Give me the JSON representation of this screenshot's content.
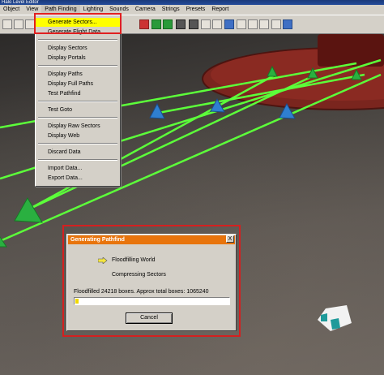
{
  "window": {
    "title": "Halo Level Editor"
  },
  "menubar": [
    {
      "label": "Object"
    },
    {
      "label": "View"
    },
    {
      "label": "Path Finding"
    },
    {
      "label": "Lighting"
    },
    {
      "label": "Sounds"
    },
    {
      "label": "Camera"
    },
    {
      "label": "Strings"
    },
    {
      "label": "Presets"
    },
    {
      "label": "Report"
    }
  ],
  "dropdown": {
    "items": [
      {
        "label": "Generate Sectors..."
      },
      {
        "label": "Generate Flight Data..."
      },
      {
        "label": "Display Sectors"
      },
      {
        "label": "Display Portals"
      },
      {
        "label": "Display Paths"
      },
      {
        "label": "Display Full Paths"
      },
      {
        "label": "Test Pathfind"
      },
      {
        "label": "Test Goto"
      },
      {
        "label": "Display Raw Sectors"
      },
      {
        "label": "Display Web"
      },
      {
        "label": "Discard Data"
      },
      {
        "label": "Import Data..."
      },
      {
        "label": "Export Data..."
      }
    ]
  },
  "dialog": {
    "title": "Generating Pathfind",
    "close_label": "X",
    "steps": [
      "Floodfilling World",
      "Compressing Sectors"
    ],
    "status": "Floodfilled 24218 boxes. Approx total boxes: 1065240",
    "progress": 0.023,
    "cancel_label": "Cancel"
  },
  "colors": {
    "highlight": "#ffff00",
    "dialog_title": "#e8740c",
    "annotation": "#e02020",
    "path_line": "#5cff3a",
    "node_green": "#2ab040",
    "node_blue": "#2f7fd0",
    "platform": "#8a2a22"
  }
}
